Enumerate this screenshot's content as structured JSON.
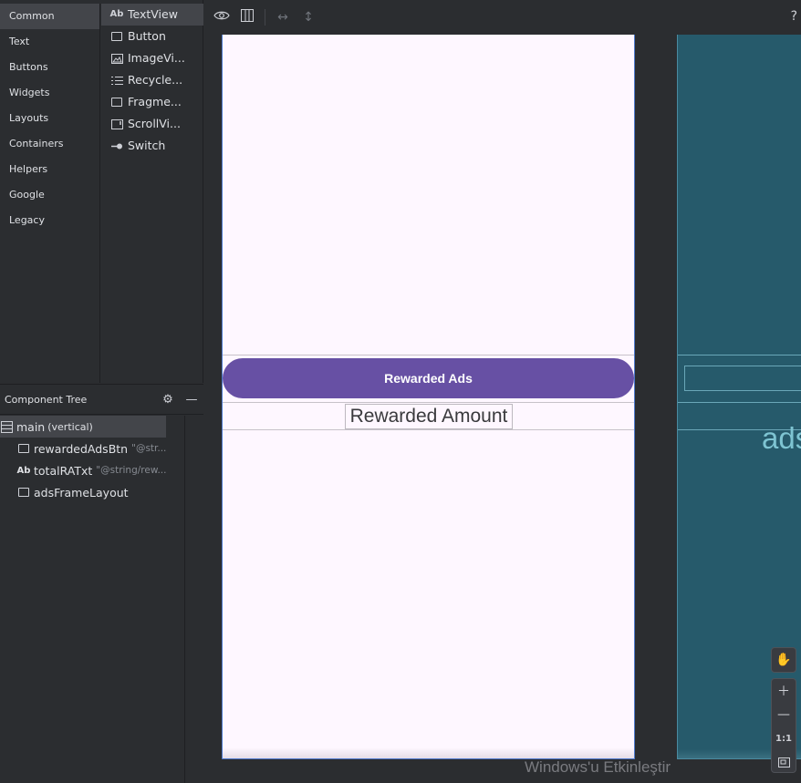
{
  "palette": {
    "categories": [
      "Common",
      "Text",
      "Buttons",
      "Widgets",
      "Layouts",
      "Containers",
      "Helpers",
      "Google",
      "Legacy"
    ],
    "widgets": [
      {
        "icon": "Ab",
        "label": "TextView"
      },
      {
        "icon": "box",
        "label": "Button"
      },
      {
        "icon": "image",
        "label": "ImageVi..."
      },
      {
        "icon": "list",
        "label": "Recycle..."
      },
      {
        "icon": "box",
        "label": "Fragme..."
      },
      {
        "icon": "scroll",
        "label": "ScrollVi..."
      },
      {
        "icon": "switch",
        "label": "Switch"
      }
    ]
  },
  "component_tree": {
    "title": "Component Tree",
    "items": [
      {
        "icon": "layout",
        "name": "main",
        "sub": "(vertical)",
        "hint": ""
      },
      {
        "icon": "box",
        "name": "rewardedAdsBtn",
        "sub": "",
        "hint": "\"@str..."
      },
      {
        "icon": "Ab",
        "name": "totalRATxt",
        "sub": "",
        "hint": "\"@string/rew..."
      },
      {
        "icon": "box",
        "name": "adsFrameLayout",
        "sub": "",
        "hint": ""
      }
    ]
  },
  "toolbar": {
    "help": "?"
  },
  "design": {
    "button_label": "Rewarded Ads",
    "amount_label": "Rewarded Amount",
    "button_color": "#6750a4",
    "background_color": "#fef7ff"
  },
  "blueprint": {
    "text": "ads",
    "background_color": "#265a6b"
  },
  "zoom": {
    "one_to_one": "1:1"
  },
  "watermark": "Windows'u Etkinleştir"
}
